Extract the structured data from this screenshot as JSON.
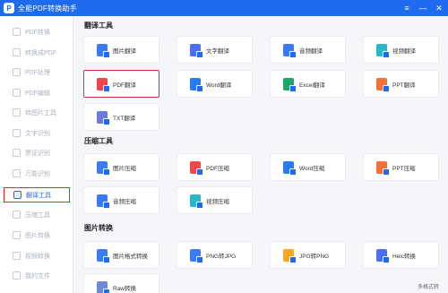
{
  "app": {
    "title": "全能PDF转换助手",
    "logo_glyph": "P"
  },
  "window_controls": {
    "menu": "≡",
    "minimize": "—",
    "close": "✕"
  },
  "sidebar": {
    "items": [
      {
        "label": "PDF转换",
        "active": false
      },
      {
        "label": "转换成PDF",
        "active": false
      },
      {
        "label": "PDF处理",
        "active": false
      },
      {
        "label": "PDF编辑",
        "active": false
      },
      {
        "label": "转图片工具",
        "active": false
      },
      {
        "label": "文字识别",
        "active": false
      },
      {
        "label": "票证识别",
        "active": false
      },
      {
        "label": "万能识别",
        "active": false
      },
      {
        "label": "翻译工具",
        "active": true
      },
      {
        "label": "压缩工具",
        "active": false
      },
      {
        "label": "图片转换",
        "active": false
      },
      {
        "label": "视频转换",
        "active": false
      },
      {
        "label": "我的文件",
        "active": false
      }
    ]
  },
  "sections": [
    {
      "title": "翻译工具",
      "tools": [
        {
          "label": "图片翻译",
          "icon": "image-translate-icon",
          "color": "#3b7cf5"
        },
        {
          "label": "文字翻译",
          "icon": "text-translate-icon",
          "color": "#4c6ef5"
        },
        {
          "label": "音频翻译",
          "icon": "audio-translate-icon",
          "color": "#3b7cf5"
        },
        {
          "label": "视频翻译",
          "icon": "video-translate-icon",
          "color": "#29b6c8"
        },
        {
          "label": "PDF翻译",
          "icon": "pdf-translate-icon",
          "color": "#f0484a",
          "highlight": true
        },
        {
          "label": "Word翻译",
          "icon": "word-translate-icon",
          "color": "#2b7bf0"
        },
        {
          "label": "Excel翻译",
          "icon": "excel-translate-icon",
          "color": "#21a366"
        },
        {
          "label": "PPT翻译",
          "icon": "ppt-translate-icon",
          "color": "#f2713a"
        },
        {
          "label": "TXT翻译",
          "icon": "txt-translate-icon",
          "color": "#6b7bd6"
        }
      ]
    },
    {
      "title": "压缩工具",
      "tools": [
        {
          "label": "图片压缩",
          "icon": "image-compress-icon",
          "color": "#3b7cf5"
        },
        {
          "label": "PDF压缩",
          "icon": "pdf-compress-icon",
          "color": "#f0484a"
        },
        {
          "label": "Word压缩",
          "icon": "word-compress-icon",
          "color": "#2b7bf0"
        },
        {
          "label": "PPT压缩",
          "icon": "ppt-compress-icon",
          "color": "#f2713a"
        },
        {
          "label": "音频压缩",
          "icon": "audio-compress-icon",
          "color": "#3b7cf5"
        },
        {
          "label": "视频压缩",
          "icon": "video-compress-icon",
          "color": "#29b6c8"
        }
      ]
    },
    {
      "title": "图片转换",
      "tools": [
        {
          "label": "图片格式转换",
          "icon": "image-format-convert-icon",
          "color": "#3b7cf5"
        },
        {
          "label": "PNG转JPG",
          "icon": "png-to-jpg-icon",
          "color": "#3b7cf5"
        },
        {
          "label": "JPG转PNG",
          "icon": "jpg-to-png-icon",
          "color": "#f5a623"
        },
        {
          "label": "Heic转换",
          "icon": "heic-convert-icon",
          "color": "#4c6ef5"
        },
        {
          "label": "Raw转换",
          "icon": "raw-convert-icon",
          "color": "#6b8bd6"
        }
      ]
    }
  ],
  "footer": {
    "link": "多格式转"
  }
}
